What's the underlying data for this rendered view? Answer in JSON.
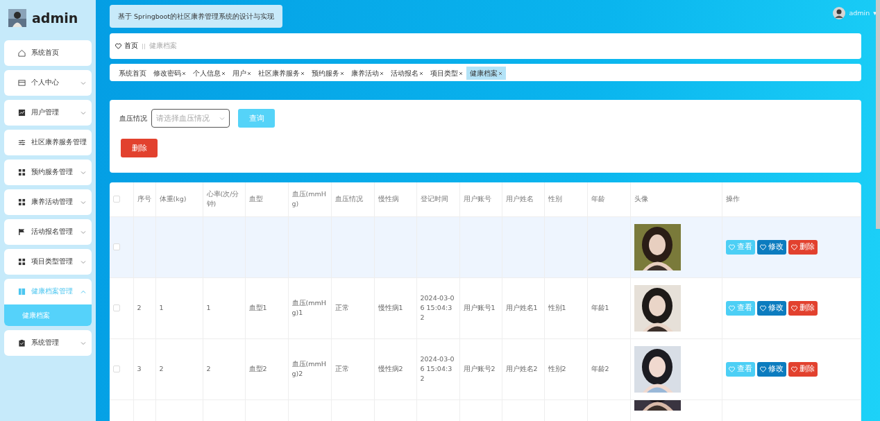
{
  "header": {
    "system_title": "基于 Springboot的社区康养管理系统的设计与实现",
    "user": {
      "name": "admin",
      "caret": "▾"
    }
  },
  "sidebar": {
    "brand": "admin",
    "items": [
      {
        "label": "系统首页",
        "selected": false
      },
      {
        "label": "个人中心",
        "expanded": false,
        "selected": false
      },
      {
        "label": "用户管理",
        "expanded": false,
        "selected": false
      },
      {
        "label": "社区康养服务管理",
        "selected": false
      },
      {
        "label": "预约服务管理",
        "expanded": false,
        "selected": false
      },
      {
        "label": "康养活动管理",
        "expanded": false,
        "selected": false
      },
      {
        "label": "活动报名管理",
        "expanded": false,
        "selected": false
      },
      {
        "label": "项目类型管理",
        "expanded": false,
        "selected": false
      },
      {
        "label": "健康档案管理",
        "expanded": true,
        "selected": true,
        "children": [
          {
            "label": "健康档案",
            "selected": true
          }
        ]
      },
      {
        "label": "系统管理",
        "expanded": false,
        "selected": false
      }
    ]
  },
  "breadcrumb": [
    {
      "label": "首页"
    },
    {
      "label": "健康档案"
    }
  ],
  "tabs": [
    {
      "label": "系统首页",
      "closable": false,
      "selected": false
    },
    {
      "label": "修改密码",
      "closable": true,
      "selected": false
    },
    {
      "label": "个人信息",
      "closable": true,
      "selected": false
    },
    {
      "label": "用户",
      "closable": true,
      "selected": false
    },
    {
      "label": "社区康养服务",
      "closable": true,
      "selected": false
    },
    {
      "label": "预约服务",
      "closable": true,
      "selected": false
    },
    {
      "label": "康养活动",
      "closable": true,
      "selected": false
    },
    {
      "label": "活动报名",
      "closable": true,
      "selected": false
    },
    {
      "label": "项目类型",
      "closable": true,
      "selected": false
    },
    {
      "label": "健康档案",
      "closable": true,
      "selected": true
    }
  ],
  "filter": {
    "label": "血压情况",
    "placeholder": "请选择血压情况",
    "search_button": "查询",
    "delete_button": "删除"
  },
  "table": {
    "header_checked": false,
    "columns": [
      "序号",
      "体重(kg)",
      "心率(次/分钟)",
      "血型",
      "血压(mmHg)",
      "血压情况",
      "慢性病",
      "登记时间",
      "用户账号",
      "用户姓名",
      "性别",
      "年龄",
      "头像",
      "操作"
    ],
    "rows": [
      {
        "kind": "faded",
        "checked": false,
        "hovered": true,
        "actions": [
          {
            "label": "查看",
            "kind": "view"
          },
          {
            "label": "修改",
            "kind": "edit"
          },
          {
            "label": "删除",
            "kind": "delete"
          }
        ]
      },
      {
        "kind": "full",
        "checked": false,
        "hovered": false,
        "cells": [
          "2",
          "1",
          "1",
          "血型1",
          "血压(mmHg)1",
          "正常",
          "慢性病1",
          "2024-03-06 15:04:32",
          "用户账号1",
          "用户姓名1",
          "性别1",
          "年龄1"
        ],
        "actions": [
          {
            "label": "查看",
            "kind": "view"
          },
          {
            "label": "修改",
            "kind": "edit"
          },
          {
            "label": "删除",
            "kind": "delete"
          }
        ]
      },
      {
        "kind": "full",
        "checked": false,
        "hovered": false,
        "cells": [
          "3",
          "2",
          "2",
          "血型2",
          "血压(mmHg)2",
          "正常",
          "慢性病2",
          "2024-03-06 15:04:32",
          "用户账号2",
          "用户姓名2",
          "性别2",
          "年龄2"
        ],
        "actions": [
          {
            "label": "查看",
            "kind": "view"
          },
          {
            "label": "修改",
            "kind": "edit"
          },
          {
            "label": "删除",
            "kind": "delete"
          }
        ]
      },
      {
        "kind": "partial",
        "hovered": false
      }
    ]
  }
}
